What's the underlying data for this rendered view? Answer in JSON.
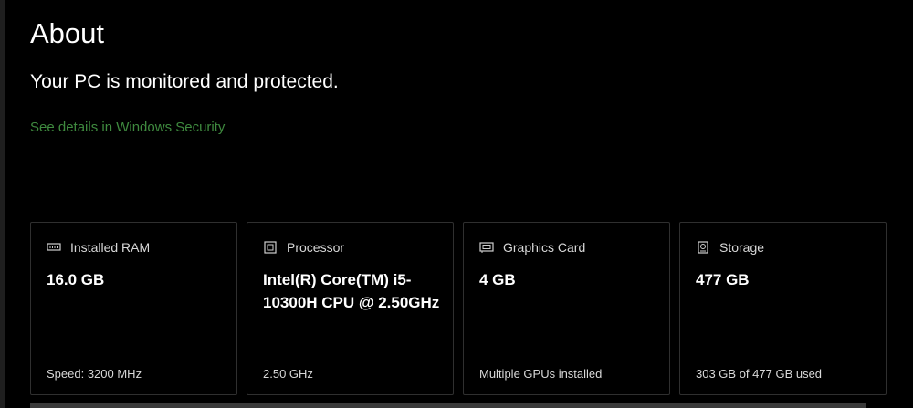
{
  "page": {
    "title": "About",
    "status": "Your PC is monitored and protected.",
    "security_link": "See details in Windows Security",
    "link_color": "#3f8a3f"
  },
  "cards": [
    {
      "icon": "ram-icon",
      "label": "Installed RAM",
      "value": "16.0 GB",
      "footer": "Speed: 3200 MHz"
    },
    {
      "icon": "processor-icon",
      "label": "Processor",
      "value": "Intel(R) Core(TM) i5-10300H CPU @ 2.50GHz",
      "footer": "2.50 GHz"
    },
    {
      "icon": "graphics-card-icon",
      "label": "Graphics Card",
      "value": "4 GB",
      "footer": "Multiple GPUs installed"
    },
    {
      "icon": "storage-icon",
      "label": "Storage",
      "value": "477 GB",
      "footer": "303 GB of 477 GB used"
    }
  ]
}
